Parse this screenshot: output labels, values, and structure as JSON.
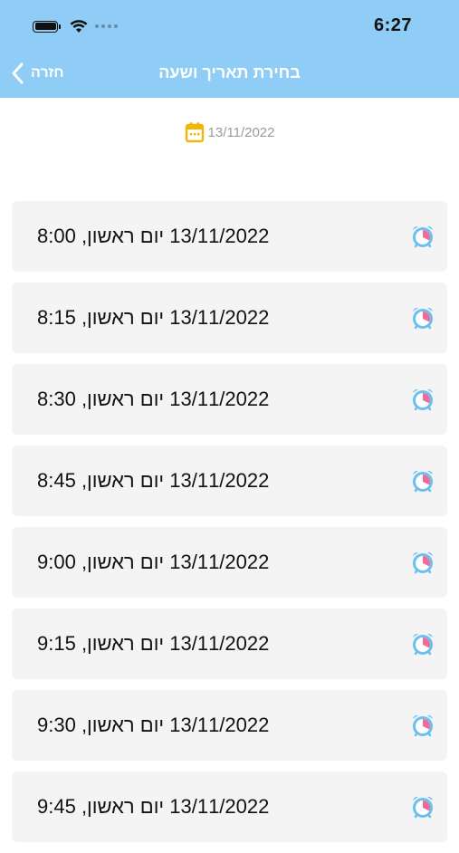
{
  "status_bar": {
    "time": "6:27"
  },
  "nav": {
    "title": "בחירת תאריך ושעה",
    "back_label": "חזרה"
  },
  "date_picker": {
    "date": "13/11/2022"
  },
  "slots": [
    {
      "label": "13/11/2022 יום ראשון, 8:00"
    },
    {
      "label": "13/11/2022 יום ראשון, 8:15"
    },
    {
      "label": "13/11/2022 יום ראשון, 8:30"
    },
    {
      "label": "13/11/2022 יום ראשון, 8:45"
    },
    {
      "label": "13/11/2022 יום ראשון, 9:00"
    },
    {
      "label": "13/11/2022 יום ראשון, 9:15"
    },
    {
      "label": "13/11/2022 יום ראשון, 9:30"
    },
    {
      "label": "13/11/2022 יום ראשון, 9:45"
    }
  ],
  "icons": {
    "back": "chevron-left-icon",
    "date": "calendar-icon",
    "slot": "alarm-clock-icon"
  },
  "colors": {
    "header": "#8fcdf6",
    "calendar": "#f2b705",
    "alarm_body": "#6cc0f0",
    "alarm_wedge": "#f06b9a"
  }
}
